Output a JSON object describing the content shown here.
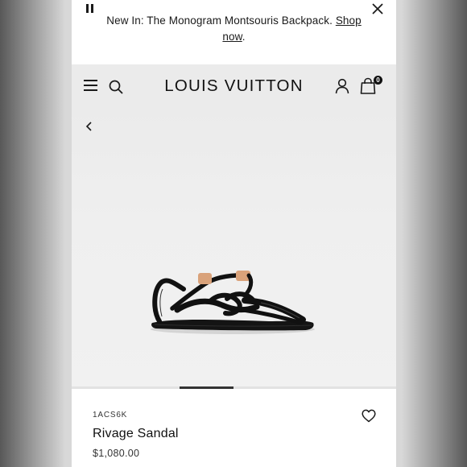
{
  "banner": {
    "message": "New In: The Monogram Montsouris Backpack.",
    "link_label": "Shop now",
    "link_end": "."
  },
  "header": {
    "logo": "LOUIS VUITTON",
    "cart_count": "0"
  },
  "icons": {
    "pause": "pause-icon",
    "close": "close-icon",
    "menu": "hamburger-menu-icon",
    "search": "search-icon",
    "account": "account-icon",
    "bag": "shopping-bag-icon",
    "back": "chevron-left-icon",
    "wishlist": "heart-icon"
  },
  "gallery": {
    "image_alt": "Rivage Sandal"
  },
  "product": {
    "sku": "1ACS6K",
    "name": "Rivage Sandal",
    "price": "$1,080.00"
  }
}
